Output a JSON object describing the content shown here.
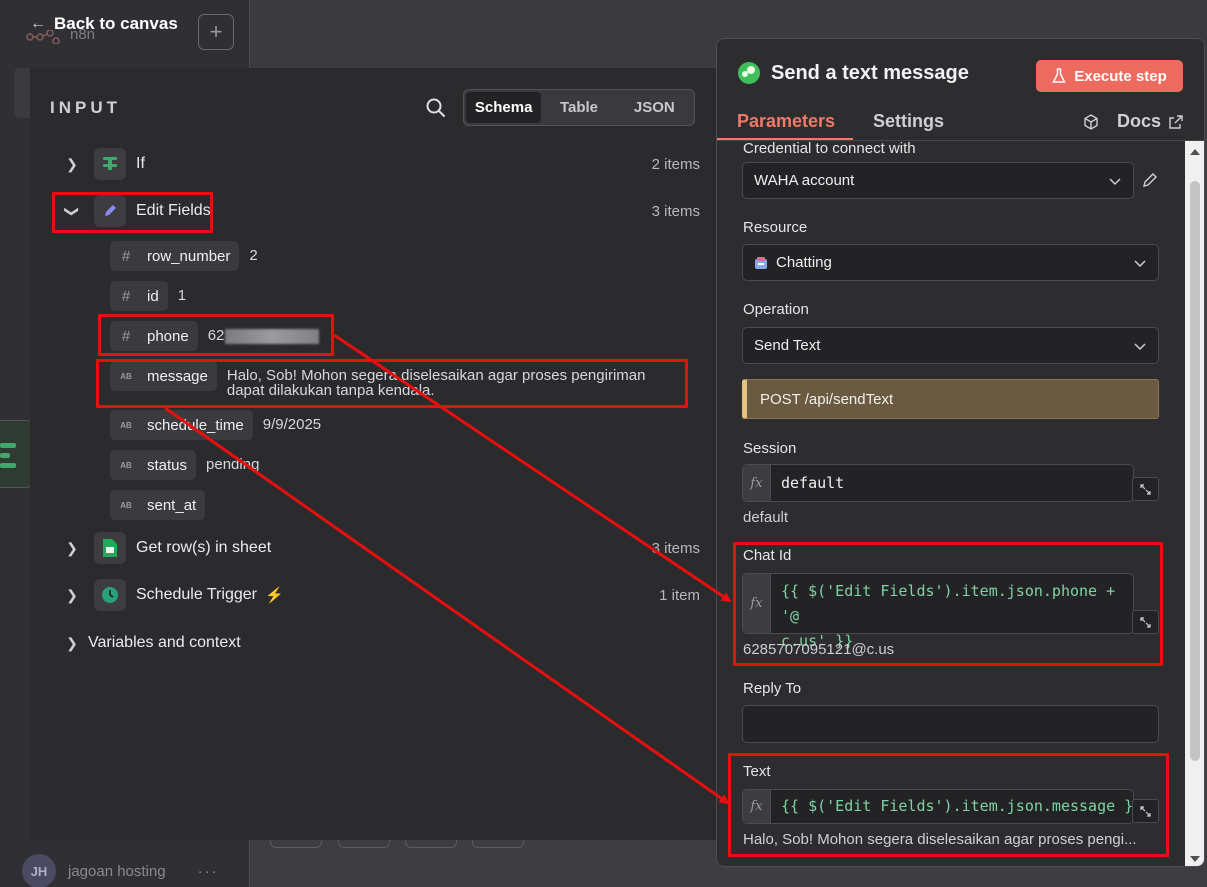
{
  "app": {
    "logo_text": "n8n",
    "back_label": "Back to canvas",
    "user_initials": "JH",
    "user_name": "jagoan hosting",
    "more": "···"
  },
  "input_panel": {
    "title": "INPUT",
    "view_tabs": [
      {
        "label": "Schema",
        "active": true
      },
      {
        "label": "Table",
        "active": false
      },
      {
        "label": "JSON",
        "active": false
      }
    ],
    "nodes": [
      {
        "label": "If",
        "count": "2 items"
      },
      {
        "label": "Edit Fields",
        "count": "3 items"
      },
      {
        "label": "Get row(s) in sheet",
        "count": "3 items"
      },
      {
        "label": "Schedule Trigger",
        "count": "1 item"
      },
      {
        "label": "Variables and context",
        "count": ""
      }
    ],
    "fields": [
      {
        "type": "#",
        "name": "row_number",
        "value": "2"
      },
      {
        "type": "#",
        "name": "id",
        "value": "1"
      },
      {
        "type": "#",
        "name": "phone",
        "value": "62"
      },
      {
        "type": "AB",
        "name": "message",
        "value": "Halo, Sob! Mohon segera diselesaikan agar proses pengiriman",
        "value2": "dapat dilakukan tanpa kendala."
      },
      {
        "type": "AB",
        "name": "schedule_time",
        "value": "9/9/2025"
      },
      {
        "type": "AB",
        "name": "status",
        "value": "pending"
      },
      {
        "type": "AB",
        "name": "sent_at",
        "value": ""
      }
    ]
  },
  "node_panel": {
    "title": "Send a text message",
    "execute_label": "Execute step",
    "tabs": {
      "parameters": "Parameters",
      "settings": "Settings",
      "docs": "Docs"
    },
    "credential": {
      "label": "Credential to connect with",
      "value": "WAHA account"
    },
    "resource": {
      "label": "Resource",
      "value": "Chatting"
    },
    "operation": {
      "label": "Operation",
      "value": "Send Text"
    },
    "endpoint": "POST /api/sendText",
    "session": {
      "label": "Session",
      "value": "default",
      "hint": "default"
    },
    "chat_id": {
      "label": "Chat Id",
      "line1": "{{ $('Edit Fields').item.json.phone + '@",
      "line2": "c.us' }}",
      "hint": "6285707095121@c.us"
    },
    "reply_to": {
      "label": "Reply To",
      "value": ""
    },
    "text": {
      "label": "Text",
      "value": "{{ $('Edit Fields').item.json.message }",
      "hint": "Halo, Sob! Mohon segera diselesaikan agar proses pengi..."
    }
  },
  "colors": {
    "accent": "#ef7a68",
    "execute": "#ec6a5e",
    "expr_green": "#7ed3a3",
    "annotation": "#e80f0f"
  }
}
